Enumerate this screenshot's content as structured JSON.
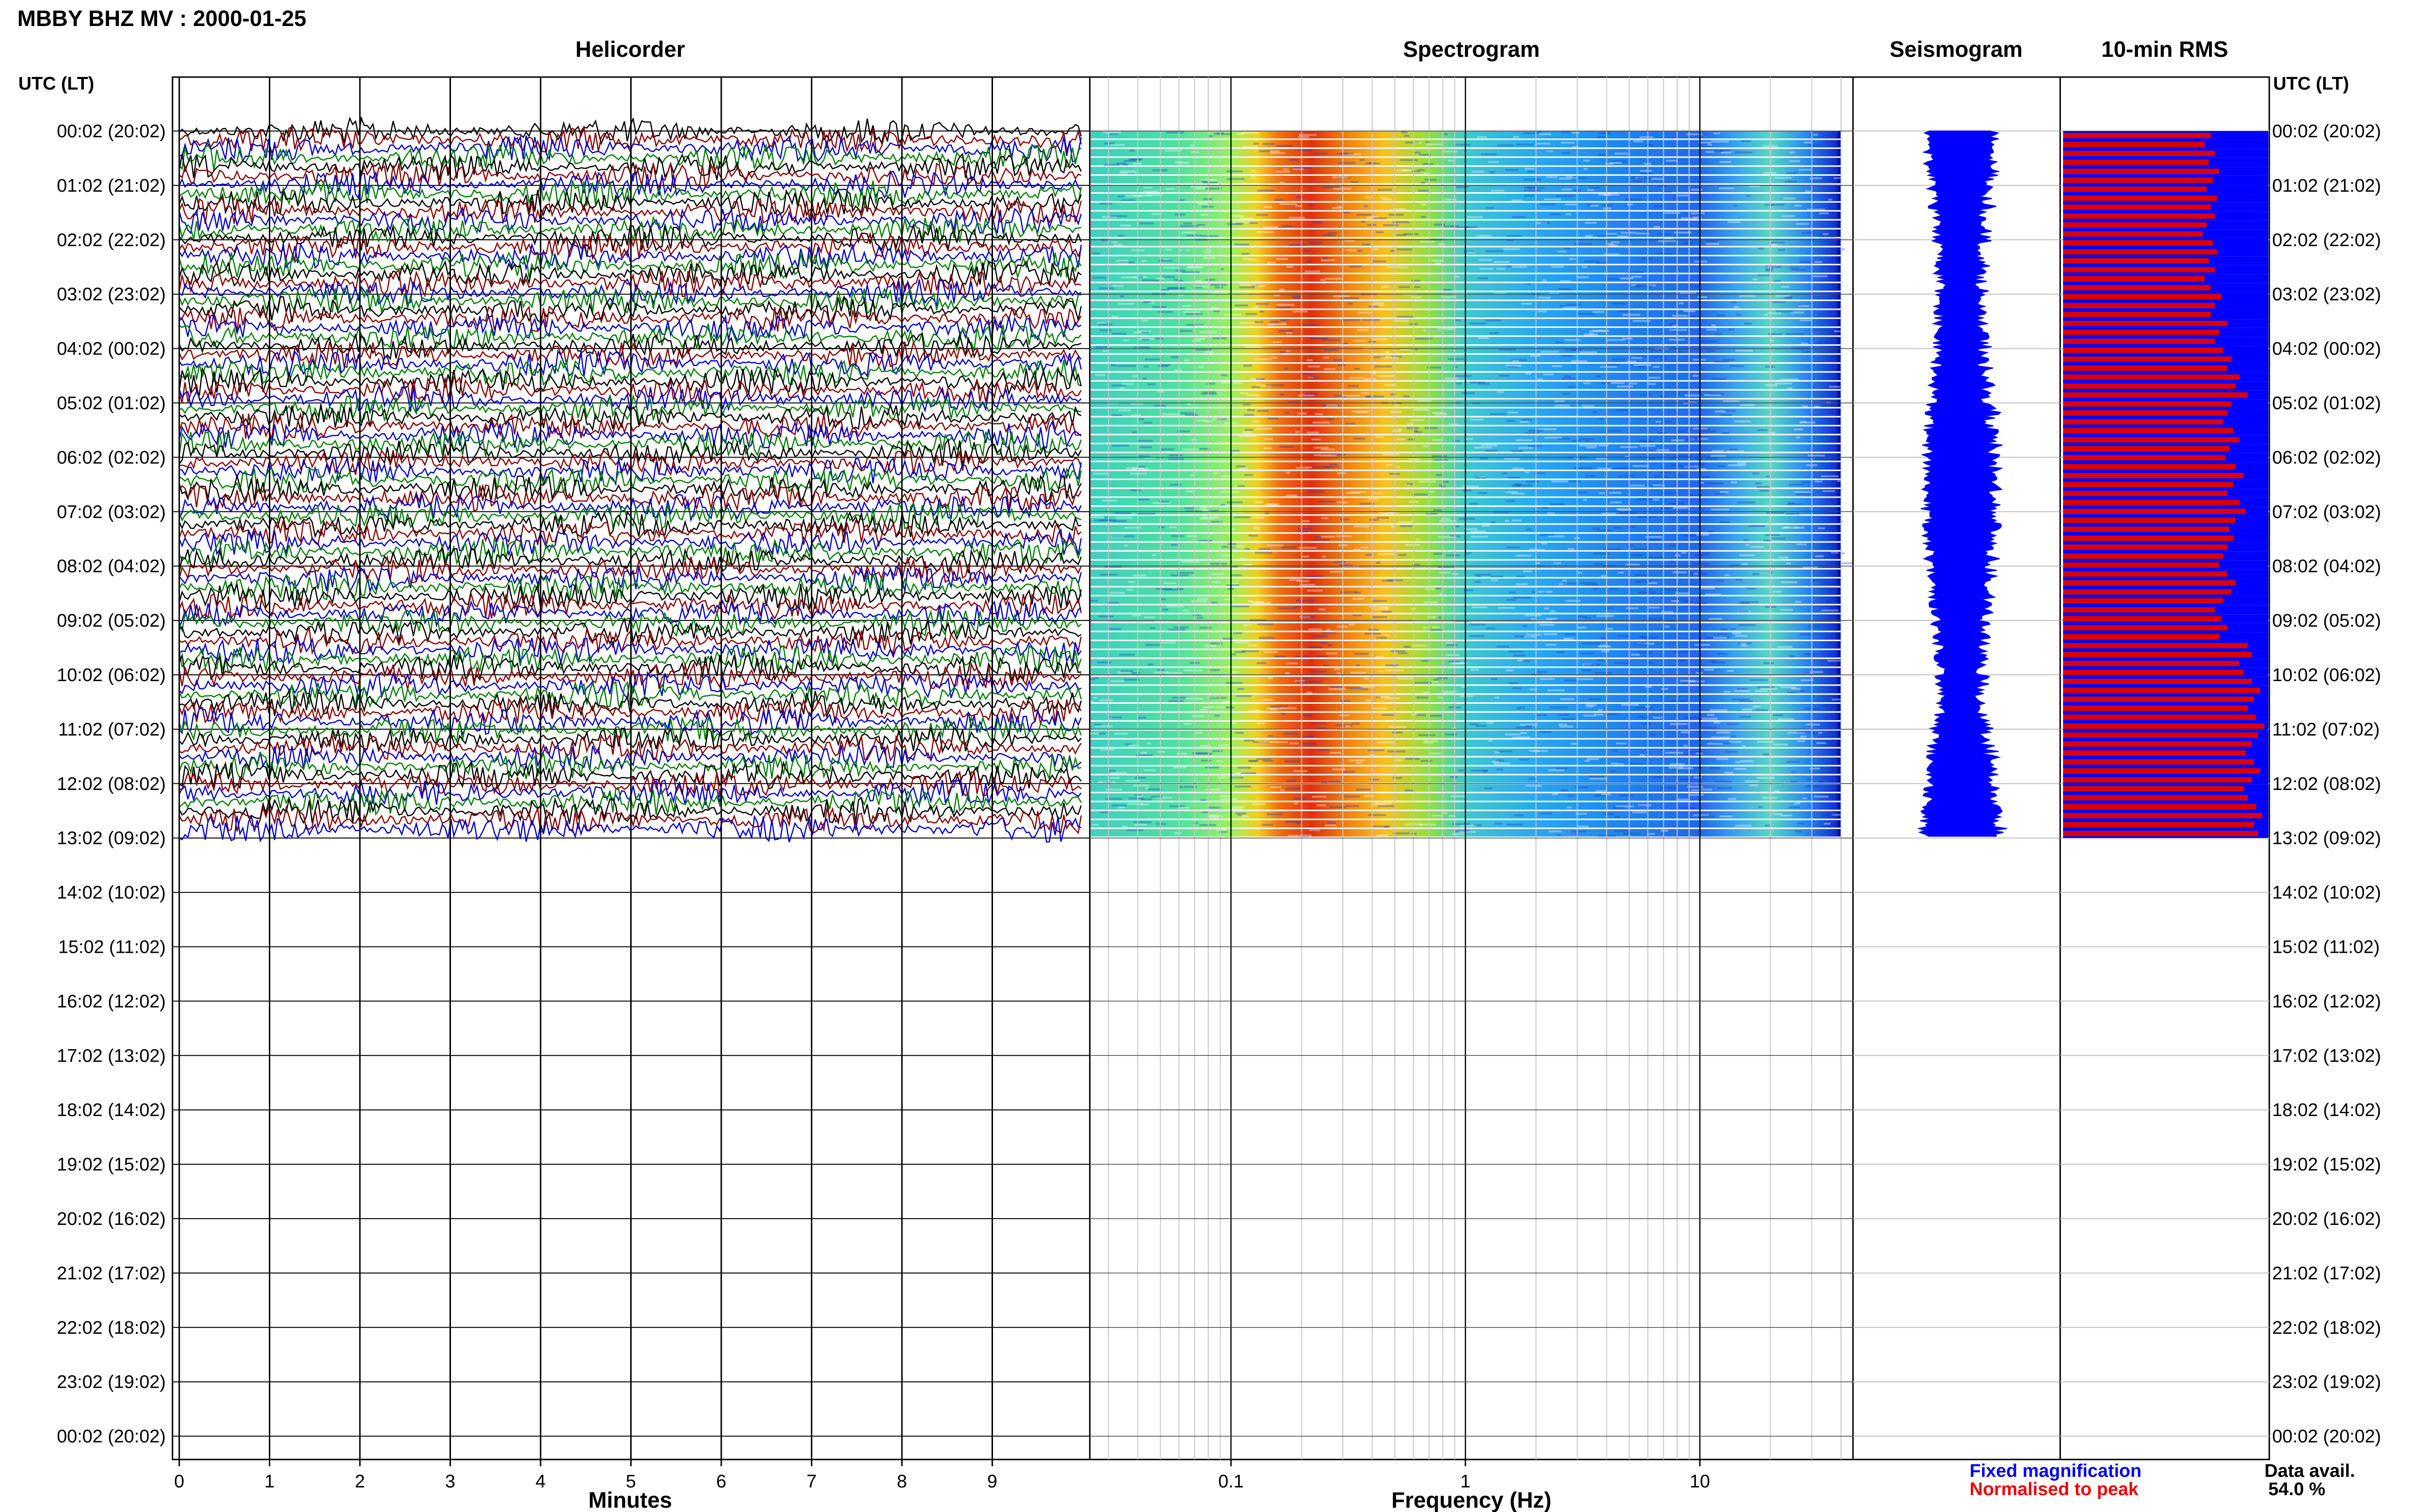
{
  "header": {
    "title": "MBBY BHZ MV : 2000-01-25"
  },
  "panels": {
    "helicorder": "Helicorder",
    "spectrogram": "Spectrogram",
    "seismogram": "Seismogram",
    "rms": "10-min RMS"
  },
  "axes": {
    "time_header_left": "UTC (LT)",
    "time_header_right": "UTC (LT)",
    "minutes_title": "Minutes",
    "frequency_title": "Frequency (Hz)"
  },
  "legend": {
    "fixed": "Fixed magnification",
    "normalised": "Normalised to peak",
    "fixed_color": "#0000ee",
    "normalised_color": "#ee0000"
  },
  "availability": {
    "label": "Data avail.",
    "value": "54.0 %"
  },
  "colors": {
    "trace_cycle": [
      "#000000",
      "#8b0000",
      "#0000cc",
      "#008000"
    ],
    "seismogram": "#0000ff",
    "rms_fixed": "#0000ff",
    "rms_normalised": "#dd0000"
  },
  "chart_data": [
    {
      "type": "line",
      "title": "Helicorder",
      "xlabel": "Minutes",
      "x_ticks": [
        "0",
        "1",
        "2",
        "3",
        "4",
        "5",
        "6",
        "7",
        "8",
        "9"
      ],
      "xlim": [
        0,
        10
      ],
      "y_ticks": [
        "00:02 (20:02)",
        "01:02 (21:02)",
        "02:02 (22:02)",
        "03:02 (23:02)",
        "04:02 (00:02)",
        "05:02 (01:02)",
        "06:02 (02:02)",
        "07:02 (03:02)",
        "08:02 (04:02)",
        "09:02 (05:02)",
        "10:02 (06:02)",
        "11:02 (07:02)",
        "12:02 (08:02)",
        "13:02 (09:02)",
        "14:02 (10:02)",
        "15:02 (11:02)",
        "16:02 (12:02)",
        "17:02 (13:02)",
        "18:02 (14:02)",
        "19:02 (15:02)",
        "20:02 (16:02)",
        "21:02 (17:02)",
        "22:02 (18:02)",
        "23:02 (19:02)",
        "00:02 (20:02)"
      ],
      "trace_lines": 79,
      "hours_with_data": 13
    },
    {
      "type": "heatmap",
      "title": "Spectrogram",
      "xlabel": "Frequency (Hz)",
      "x_scale": "log",
      "x_ticks": [
        "0.1",
        "1",
        "10"
      ],
      "xlim": [
        0.025,
        45
      ],
      "data_until_hz": 40,
      "peak_band_hz": [
        0.15,
        0.6
      ],
      "secondary_band_hz": [
        15,
        25
      ],
      "colormap": "jet",
      "rows": 79
    },
    {
      "type": "line",
      "title": "Seismogram",
      "hours_with_data": 13
    },
    {
      "type": "bar",
      "title": "10-min RMS",
      "series": [
        {
          "name": "Fixed magnification",
          "values": [
            1,
            1,
            1,
            1,
            1,
            1,
            1,
            1,
            1,
            1,
            1,
            1,
            1,
            1,
            1,
            1,
            1,
            1,
            1,
            1,
            1,
            1,
            1,
            1,
            1,
            1,
            1,
            1,
            1,
            1,
            1,
            1,
            1,
            1,
            1,
            1,
            1,
            1,
            1,
            1,
            1,
            1,
            1,
            1,
            1,
            1,
            1,
            1,
            1,
            1,
            1,
            1,
            1,
            1,
            1,
            1,
            1,
            1,
            1,
            1,
            1,
            1,
            1,
            1,
            1,
            1,
            1,
            1,
            1,
            1,
            1,
            1,
            1,
            1,
            1,
            1,
            1,
            1,
            1
          ]
        },
        {
          "name": "Normalised to peak",
          "values": [
            0.72,
            0.69,
            0.74,
            0.71,
            0.76,
            0.73,
            0.7,
            0.75,
            0.72,
            0.74,
            0.7,
            0.68,
            0.73,
            0.75,
            0.71,
            0.74,
            0.69,
            0.72,
            0.77,
            0.74,
            0.72,
            0.8,
            0.76,
            0.74,
            0.78,
            0.82,
            0.8,
            0.86,
            0.84,
            0.9,
            0.82,
            0.8,
            0.78,
            0.83,
            0.86,
            0.81,
            0.79,
            0.84,
            0.88,
            0.83,
            0.8,
            0.86,
            0.89,
            0.84,
            0.81,
            0.83,
            0.8,
            0.78,
            0.76,
            0.8,
            0.84,
            0.82,
            0.78,
            0.74,
            0.77,
            0.8,
            0.76,
            0.9,
            0.92,
            0.86,
            0.88,
            0.92,
            0.96,
            0.93,
            0.9,
            0.94,
            0.98,
            0.95,
            0.92,
            0.89,
            0.93,
            0.96,
            0.92,
            0.88,
            0.9,
            0.94,
            0.97,
            0.93,
            0.95
          ]
        }
      ]
    }
  ]
}
